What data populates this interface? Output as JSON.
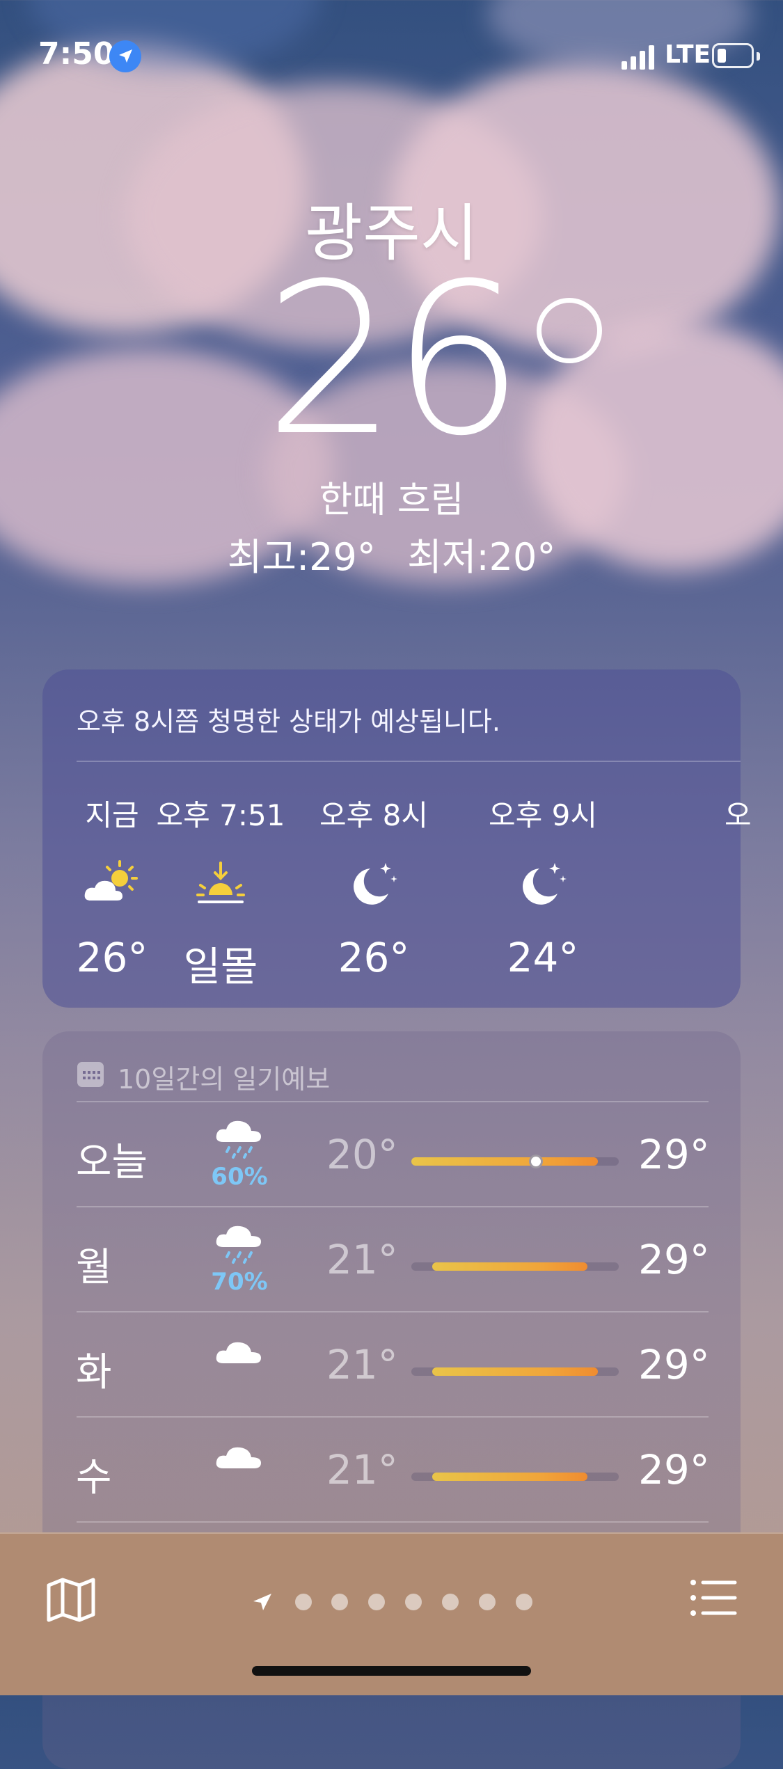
{
  "status_bar": {
    "time": "7:50",
    "network": "LTE",
    "location_icon": "location-arrow-icon",
    "battery_icon": "battery-low-icon"
  },
  "header": {
    "city": "광주시",
    "temperature": "26",
    "condition": "한때 흐림",
    "high": "최고:29°",
    "low": "최저:20°"
  },
  "hourly": {
    "summary": "오후 8시쯤 청명한 상태가 예상됩니다.",
    "items": [
      {
        "label": "지금",
        "icon": "partly-cloudy-day-icon",
        "value": "26°"
      },
      {
        "label": "오후 7:51",
        "icon": "sunset-icon",
        "value": "일몰"
      },
      {
        "label": "오후 8시",
        "icon": "moon-stars-icon",
        "value": "26°"
      },
      {
        "label": "오후 9시",
        "icon": "moon-stars-icon",
        "value": "24°"
      }
    ],
    "peek_label": "오"
  },
  "ten_day": {
    "title": "10일간의 일기예보",
    "days": [
      {
        "day": "오늘",
        "icon": "cloud-rain-icon",
        "precip": "60%",
        "low": "20°",
        "high": "29°",
        "range_start": 0.0,
        "range_end": 0.9,
        "current": 0.6
      },
      {
        "day": "월",
        "icon": "cloud-rain-icon",
        "precip": "70%",
        "low": "21°",
        "high": "29°",
        "range_start": 0.1,
        "range_end": 0.85
      },
      {
        "day": "화",
        "icon": "cloud-icon",
        "precip": "",
        "low": "21°",
        "high": "29°",
        "range_start": 0.1,
        "range_end": 0.9
      },
      {
        "day": "수",
        "icon": "cloud-icon",
        "precip": "",
        "low": "21°",
        "high": "29°",
        "range_start": 0.1,
        "range_end": 0.85
      }
    ]
  },
  "bottom_bar": {
    "map_icon": "map-icon",
    "list_icon": "list-icon",
    "page_count": 7,
    "current_page": 0
  },
  "colors": {
    "precip": "#7ec7f6",
    "sun": "#f5cf3c",
    "bar_start": "#e9c449",
    "bar_end": "#ef8c30"
  }
}
